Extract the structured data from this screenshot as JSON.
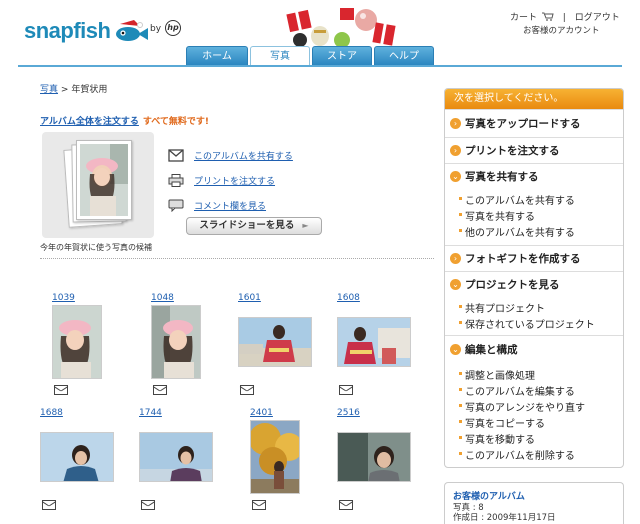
{
  "header": {
    "logo_text": "snapfish",
    "logo_by": "by",
    "logo_hp": "hp",
    "cart": "カート",
    "logout": "ログアウト",
    "account": "お客様のアカウント"
  },
  "nav": {
    "tabs": [
      {
        "label": "ホーム",
        "active": false
      },
      {
        "label": "写真",
        "active": true
      },
      {
        "label": "ストア",
        "active": false
      },
      {
        "label": "ヘルプ",
        "active": false
      }
    ]
  },
  "breadcrumb": {
    "root": "写真",
    "separator": ">",
    "current": "年賀状用"
  },
  "order": {
    "link": "アルバム全体を注文する",
    "free": "すべて無料です!"
  },
  "album": {
    "caption": "今年の年賀状に使う写真の候補",
    "actions": [
      {
        "icon": "envelope-icon",
        "label": "このアルバムを共有する"
      },
      {
        "icon": "printer-icon",
        "label": "プリントを注文する"
      },
      {
        "icon": "comment-icon",
        "label": "コメント欄を見る"
      }
    ],
    "slideshow": "スライドショーを見る",
    "slideshow_arrow": "►"
  },
  "photos": [
    {
      "num": "1039"
    },
    {
      "num": "1048"
    },
    {
      "num": "1601"
    },
    {
      "num": "1608"
    },
    {
      "num": "1688"
    },
    {
      "num": "1744"
    },
    {
      "num": "2401"
    },
    {
      "num": "2516"
    }
  ],
  "panel": {
    "head": "次を選択してください。",
    "sections": [
      {
        "title": "写真をアップロードする",
        "items": []
      },
      {
        "title": "プリントを注文する",
        "items": []
      },
      {
        "title": "写真を共有する",
        "items": [
          "このアルバムを共有する",
          "写真を共有する",
          "他のアルバムを共有する"
        ]
      },
      {
        "title": "フォトギフトを作成する",
        "items": []
      },
      {
        "title": "プロジェクトを見る",
        "items": [
          "共有プロジェクト",
          "保存されているプロジェクト"
        ]
      },
      {
        "title": "編集と構成",
        "items": [
          "調整と画像処理",
          "このアルバムを編集する",
          "写真のアレンジをやり直す",
          "写真をコピーする",
          "写真を移動する",
          "このアルバムを削除する"
        ]
      }
    ]
  },
  "album_info": {
    "title": "お客様のアルバム",
    "count_line": "写真 :   8",
    "date_line": "作成日 :   2009年11月17日"
  },
  "colors": {
    "accent_blue": "#2b86c0",
    "link_blue": "#1f5fb0",
    "orange": "#e98a10"
  }
}
